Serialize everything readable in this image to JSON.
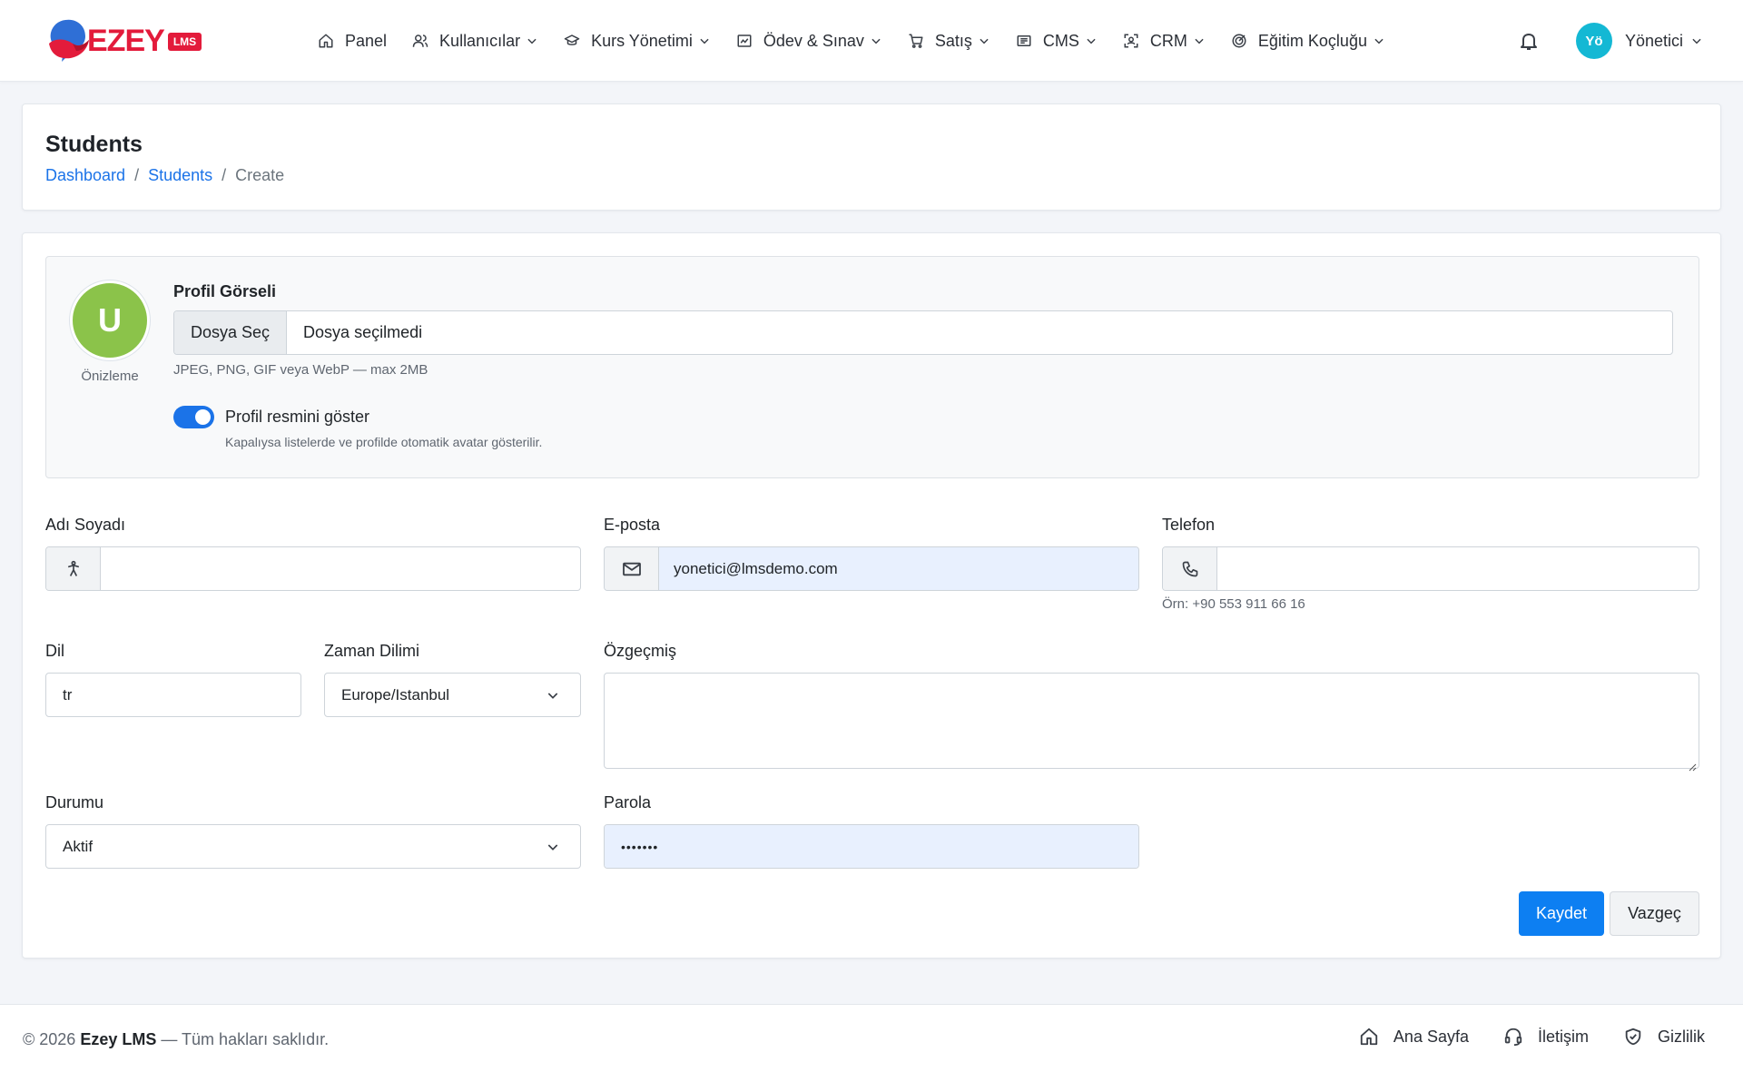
{
  "brand": {
    "name": "EZEY",
    "badge": "LMS"
  },
  "nav": {
    "items": [
      {
        "label": "Panel",
        "icon": "home-icon",
        "dropdown": false
      },
      {
        "label": "Kullanıcılar",
        "icon": "users-icon",
        "dropdown": true
      },
      {
        "label": "Kurs Yönetimi",
        "icon": "graduation-cap-icon",
        "dropdown": true
      },
      {
        "label": "Ödev & Sınav",
        "icon": "chart-board-icon",
        "dropdown": true
      },
      {
        "label": "Satış",
        "icon": "cart-icon",
        "dropdown": true
      },
      {
        "label": "CMS",
        "icon": "newspaper-icon",
        "dropdown": true
      },
      {
        "label": "CRM",
        "icon": "user-scan-icon",
        "dropdown": true
      },
      {
        "label": "Eğitim Koçluğu",
        "icon": "target-icon",
        "dropdown": true
      }
    ],
    "bell_icon": "bell-icon",
    "user": {
      "initials": "Yö",
      "name": "Yönetici",
      "avatar_color": "#14b8d4"
    }
  },
  "header": {
    "title": "Students",
    "breadcrumb": {
      "dashboard": "Dashboard",
      "students": "Students",
      "current": "Create"
    }
  },
  "profile": {
    "preview_letter": "U",
    "preview_color": "#8bc34a",
    "preview_label": "Önizleme",
    "label": "Profil Görseli",
    "choose_button": "Dosya Seç",
    "file_status": "Dosya seçilmedi",
    "file_hint": "JPEG, PNG, GIF veya WebP — max 2MB",
    "toggle_on": true,
    "toggle_label": "Profil resmini göster",
    "toggle_help": "Kapalıysa listelerde ve profilde otomatik avatar gösterilir."
  },
  "form": {
    "name": {
      "label": "Adı Soyadı",
      "value": ""
    },
    "email": {
      "label": "E-posta",
      "value": "yonetici@lmsdemo.com"
    },
    "phone": {
      "label": "Telefon",
      "value": "",
      "hint": "Örn: +90 553 911 66 16"
    },
    "language": {
      "label": "Dil",
      "placeholder": "tr"
    },
    "timezone": {
      "label": "Zaman Dilimi",
      "value": "Europe/Istanbul"
    },
    "bio": {
      "label": "Özgeçmiş",
      "value": ""
    },
    "status": {
      "label": "Durumu",
      "value": "Aktif"
    },
    "password": {
      "label": "Parola",
      "value": "•••••••"
    },
    "save_button": "Kaydet",
    "cancel_button": "Vazgeç"
  },
  "colors": {
    "primary": "#0d7ff2",
    "link": "#1b73e8",
    "brand_red": "#e31b3b"
  },
  "footer": {
    "year_prefix": "© 2026",
    "brand": "Ezey LMS",
    "rights": "— Tüm hakları saklıdır.",
    "links": [
      {
        "label": "Ana Sayfa",
        "icon": "home-icon"
      },
      {
        "label": "İletişim",
        "icon": "headset-icon"
      },
      {
        "label": "Gizlilik",
        "icon": "shield-check-icon"
      }
    ]
  }
}
